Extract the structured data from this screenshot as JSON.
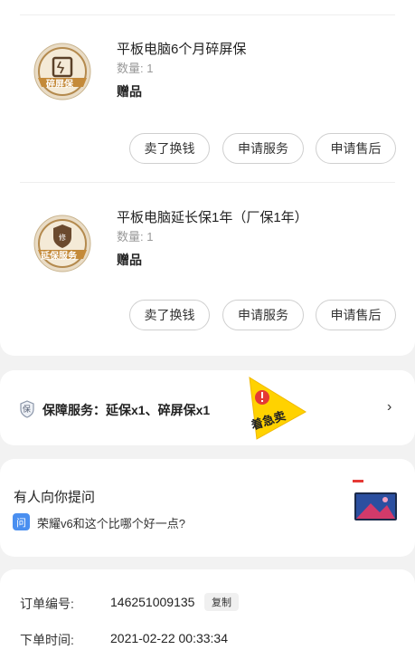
{
  "items": [
    {
      "name": "平板电脑6个月碎屏保",
      "qty": "数量: 1",
      "gift": "赠品",
      "badge_label": "碎屏保",
      "badge_icon": "broken-screen-icon",
      "buttons": [
        "卖了换钱",
        "申请服务",
        "申请售后"
      ]
    },
    {
      "name": "平板电脑延长保1年（厂保1年）",
      "qty": "数量: 1",
      "gift": "赠品",
      "badge_label": "延保服务",
      "badge_icon": "shield-badge-icon",
      "buttons": [
        "卖了换钱",
        "申请服务",
        "申请售后"
      ]
    }
  ],
  "service": {
    "icon_char": "保",
    "text": "保障服务：延保x1、碎屏保x1",
    "chevron": "›"
  },
  "hot_sticker": {
    "text": "着急卖",
    "icon": "warning-icon"
  },
  "qa": {
    "title": "有人向你提问",
    "icon_char": "问",
    "question": "荣耀v6和这个比哪个好一点?",
    "thumb_icon": "tablet-thumbnail"
  },
  "order": {
    "number_label": "订单编号:",
    "number_value": "146251009135",
    "copy_label": "复制",
    "time_label": "下单时间:",
    "time_value": "2021-02-22 00:33:34"
  },
  "colors": {
    "badge_gold": "#c48a3a",
    "badge_brown": "#7a5a3a",
    "hot_yellow": "#ffd200",
    "hot_red": "#e53935",
    "qa_blue": "#4a8ff0"
  }
}
